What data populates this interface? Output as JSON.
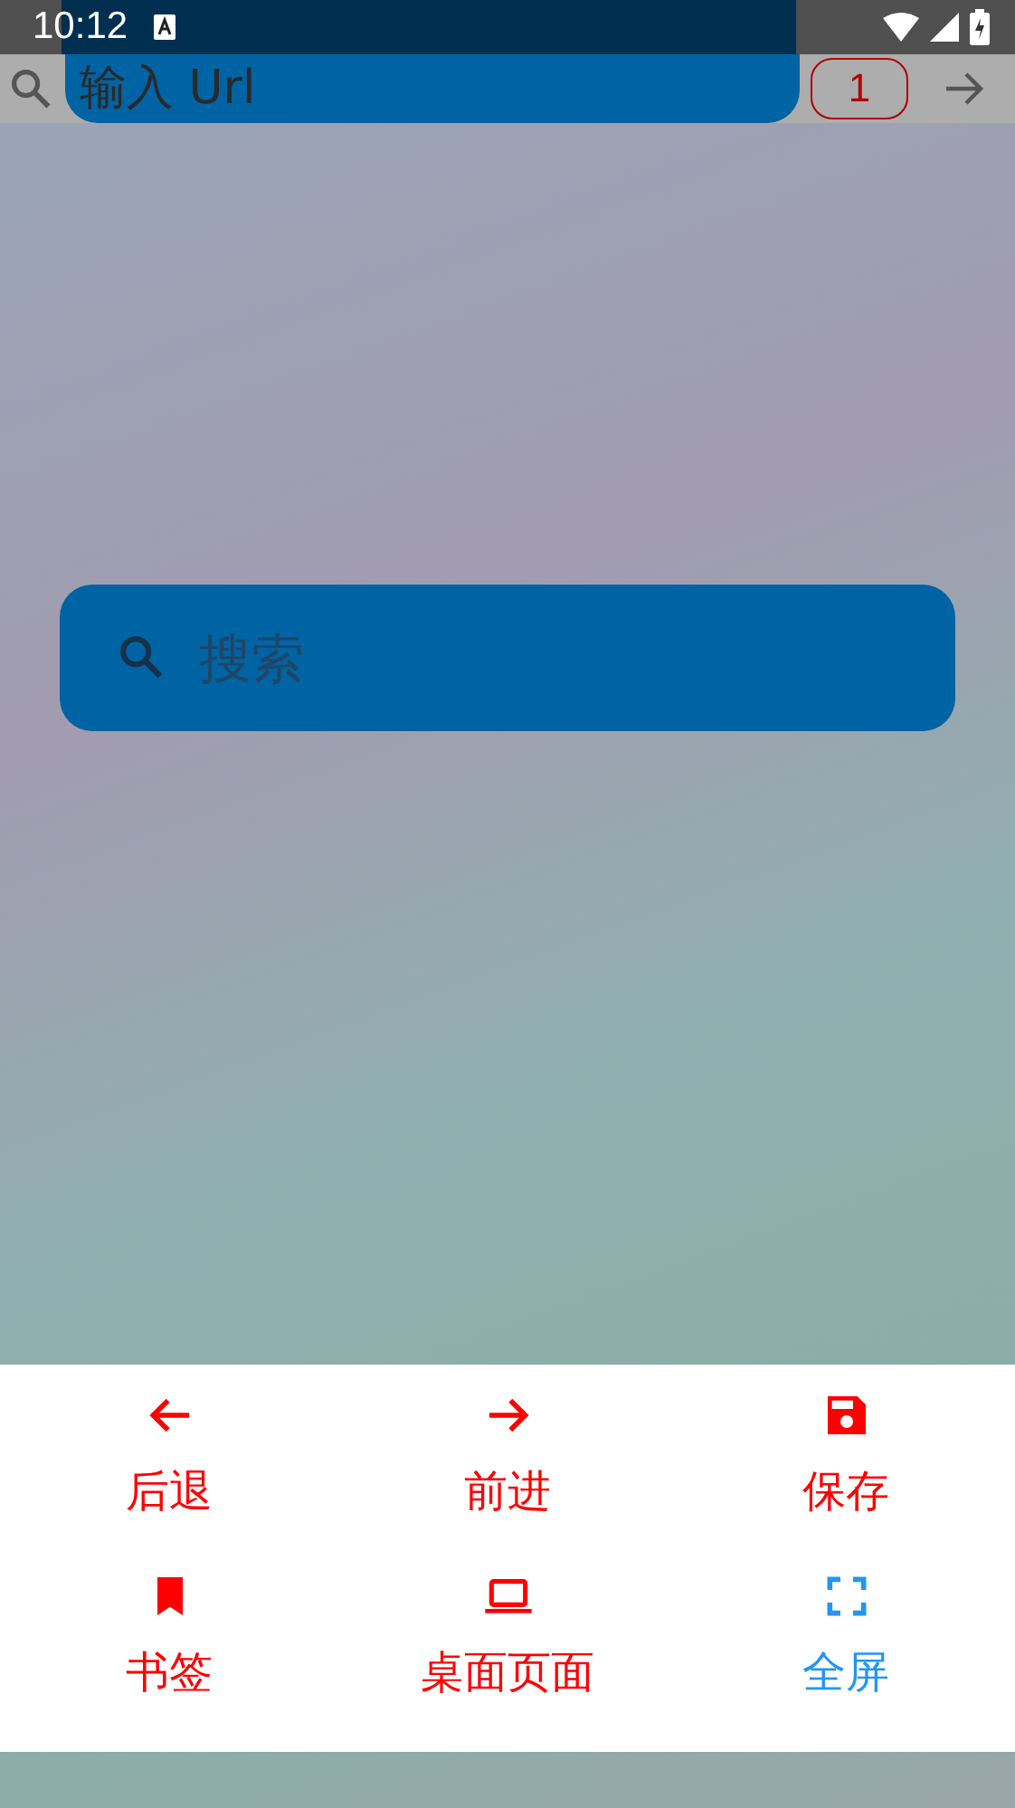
{
  "status_bar": {
    "time": "10:12"
  },
  "url_bar": {
    "placeholder": "输入 Url",
    "tab_count": "1"
  },
  "search": {
    "placeholder": "搜索"
  },
  "menu": [
    {
      "label": "后退",
      "color": "#ff0000"
    },
    {
      "label": "前进",
      "color": "#ff0000"
    },
    {
      "label": "保存",
      "color": "#ff0000"
    },
    {
      "label": "书签",
      "color": "#ff0000"
    },
    {
      "label": "桌面页面",
      "color": "#ff0000"
    },
    {
      "label": "全屏",
      "color": "#2196f3"
    }
  ]
}
